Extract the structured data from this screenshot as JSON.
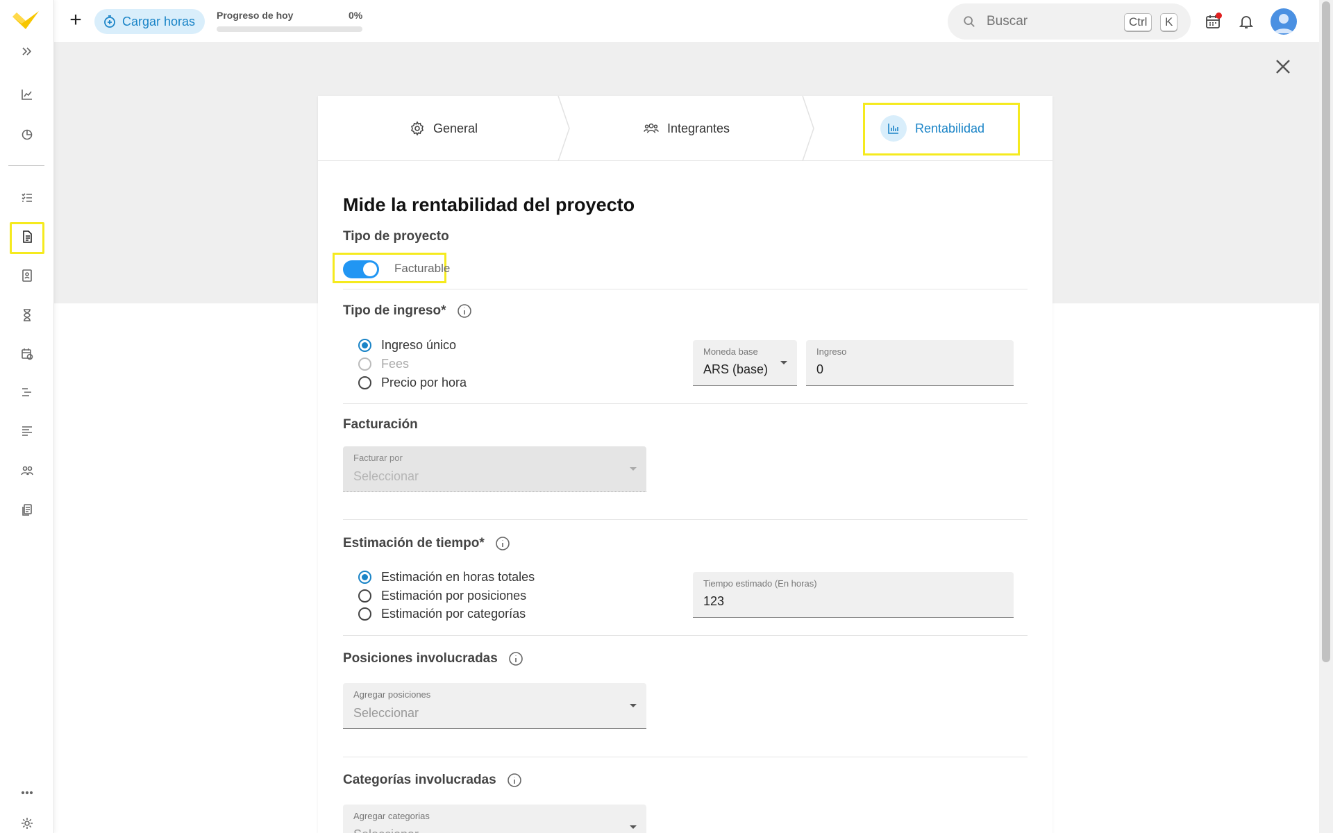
{
  "topbar": {
    "cargar_label": "Cargar horas",
    "progress_label": "Progreso de hoy",
    "progress_value": "0%",
    "progress_fraction": 0,
    "search_placeholder": "Buscar",
    "kbd_ctrl": "Ctrl",
    "kbd_k": "K"
  },
  "sidebar": {
    "icons": [
      "expand-icon",
      "chart-line-icon",
      "pie-chart-icon",
      "task-list-icon",
      "document-icon",
      "contact-card-icon",
      "hourglass-icon",
      "calendar-clock-icon",
      "gantt-icon",
      "text-lines-icon",
      "team-icon",
      "copy-docs-icon",
      "more-icon",
      "settings-icon"
    ],
    "active": "document-icon"
  },
  "stepper": {
    "steps": [
      {
        "label": "General",
        "icon": "gear-icon"
      },
      {
        "label": "Integrantes",
        "icon": "users-icon"
      },
      {
        "label": "Rentabilidad",
        "icon": "bar-chart-icon"
      }
    ],
    "active_index": 2
  },
  "form": {
    "title": "Mide la rentabilidad del proyecto",
    "tipo_proyecto_label": "Tipo de proyecto",
    "facturable_label": "Facturable",
    "facturable_on": true,
    "tipo_ingreso_label": "Tipo de ingreso*",
    "ingreso_options": [
      {
        "label": "Ingreso único",
        "state": "checked"
      },
      {
        "label": "Fees",
        "state": "disabled"
      },
      {
        "label": "Precio por hora",
        "state": "unchecked"
      }
    ],
    "moneda_label": "Moneda base",
    "moneda_value": "ARS (base)",
    "ingreso_label": "Ingreso",
    "ingreso_value": "0",
    "facturacion_label": "Facturación",
    "facturar_por_label": "Facturar por",
    "facturar_por_placeholder": "Seleccionar",
    "estimacion_label": "Estimación de tiempo*",
    "estimacion_options": [
      {
        "label": "Estimación en horas totales",
        "state": "checked"
      },
      {
        "label": "Estimación por posiciones",
        "state": "unchecked"
      },
      {
        "label": "Estimación por categorías",
        "state": "unchecked"
      }
    ],
    "tiempo_label": "Tiempo estimado (En horas)",
    "tiempo_value": "123",
    "posiciones_label": "Posiciones involucradas",
    "agregar_posiciones_label": "Agregar posiciones",
    "agregar_posiciones_placeholder": "Seleccionar",
    "categorias_label": "Categorías involucradas",
    "agregar_categorias_label": "Agregar categorias",
    "agregar_categorias_placeholder": "Seleccionar"
  },
  "colors": {
    "accent": "#1a84c7",
    "toggle": "#2196f3",
    "highlight": "#f5ea1e",
    "logo": "#f7c600"
  }
}
